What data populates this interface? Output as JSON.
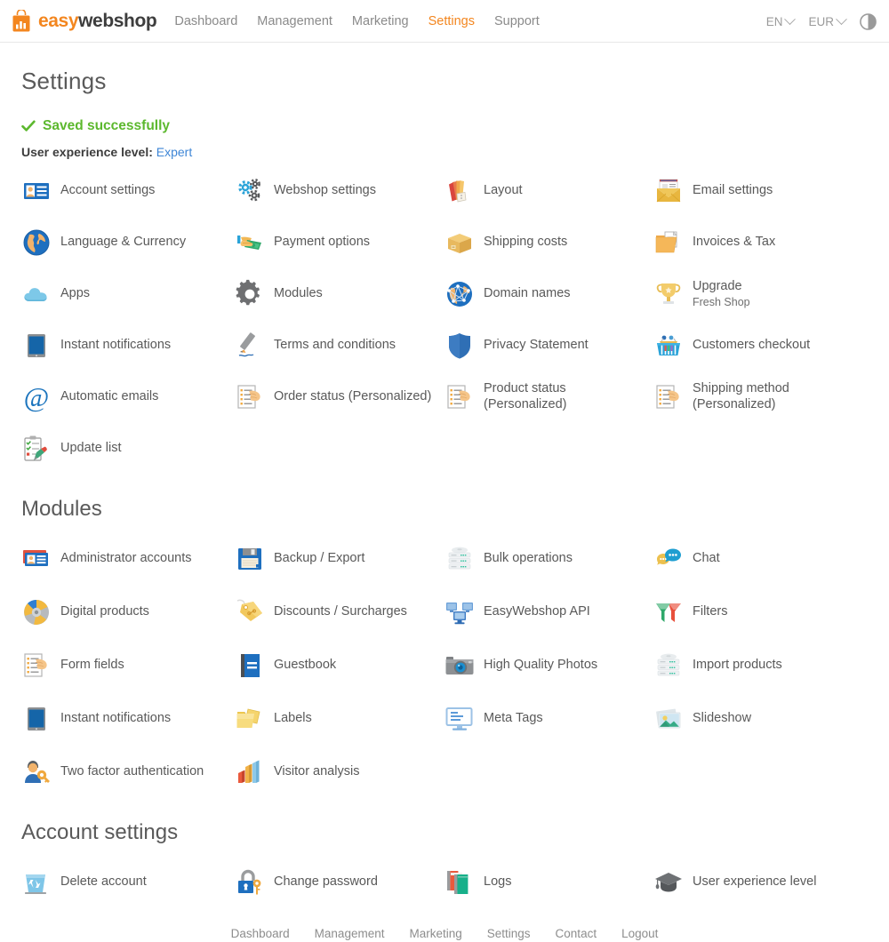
{
  "header": {
    "brand": {
      "part1": "easy",
      "part2": "webshop",
      "icon": "shopping-bag-chart-logo"
    },
    "nav": [
      {
        "label": "Dashboard",
        "active": false
      },
      {
        "label": "Management",
        "active": false
      },
      {
        "label": "Marketing",
        "active": false
      },
      {
        "label": "Settings",
        "active": true
      },
      {
        "label": "Support",
        "active": false
      }
    ],
    "language": "EN",
    "currency": "EUR",
    "theme_toggle_icon": "contrast-half-circle-icon",
    "accent_color": "#F3861F"
  },
  "page": {
    "title": "Settings",
    "saved_message": "Saved successfully",
    "saved_color": "#5cb82e",
    "ux_level_label": "User experience level:",
    "ux_level_value": "Expert",
    "ux_level_link_color": "#3e86d6"
  },
  "sections": [
    {
      "id": "settings",
      "title": "",
      "items": [
        {
          "label": "Account settings",
          "sub": "",
          "icon": "id-card-icon"
        },
        {
          "label": "Webshop settings",
          "sub": "",
          "icon": "gears-icon"
        },
        {
          "label": "Layout",
          "sub": "",
          "icon": "color-swatch-fan-icon"
        },
        {
          "label": "Email settings",
          "sub": "",
          "icon": "envelope-mail-icon"
        },
        {
          "label": "Language & Currency",
          "sub": "",
          "icon": "globe-americas-icon"
        },
        {
          "label": "Payment options",
          "sub": "",
          "icon": "hand-money-icon"
        },
        {
          "label": "Shipping costs",
          "sub": "",
          "icon": "cardboard-box-icon"
        },
        {
          "label": "Invoices & Tax",
          "sub": "",
          "icon": "folder-document-icon"
        },
        {
          "label": "Apps",
          "sub": "",
          "icon": "cloud-icon"
        },
        {
          "label": "Modules",
          "sub": "",
          "icon": "gear-icon"
        },
        {
          "label": "Domain names",
          "sub": "",
          "icon": "globe-network-icon"
        },
        {
          "label": "Upgrade",
          "sub": "Fresh Shop",
          "icon": "trophy-icon"
        },
        {
          "label": "Instant notifications",
          "sub": "",
          "icon": "tablet-device-icon"
        },
        {
          "label": "Terms and conditions",
          "sub": "",
          "icon": "pen-signature-icon"
        },
        {
          "label": "Privacy Statement",
          "sub": "",
          "icon": "shield-icon"
        },
        {
          "label": "Customers checkout",
          "sub": "",
          "icon": "shopping-basket-icon"
        },
        {
          "label": "Automatic emails",
          "sub": "",
          "icon": "at-sign-icon"
        },
        {
          "label": "Order status (Personalized)",
          "sub": "",
          "icon": "checklist-hand-icon"
        },
        {
          "label": "Product status",
          "sub": "(Personalized)",
          "icon": "checklist-hand-icon"
        },
        {
          "label": "Shipping method",
          "sub": "(Personalized)",
          "icon": "checklist-hand-icon"
        },
        {
          "label": "Update list",
          "sub": "",
          "icon": "clipboard-pencil-icon"
        }
      ]
    },
    {
      "id": "modules",
      "title": "Modules",
      "items": [
        {
          "label": "Administrator accounts",
          "sub": "",
          "icon": "id-card-red-icon"
        },
        {
          "label": "Backup / Export",
          "sub": "",
          "icon": "floppy-disk-icon"
        },
        {
          "label": "Bulk operations",
          "sub": "",
          "icon": "server-stack-icon"
        },
        {
          "label": "Chat",
          "sub": "",
          "icon": "chat-bubbles-icon"
        },
        {
          "label": "Digital products",
          "sub": "",
          "icon": "compact-disc-icon"
        },
        {
          "label": "Discounts / Surcharges",
          "sub": "",
          "icon": "price-tag-icon"
        },
        {
          "label": "EasyWebshop API",
          "sub": "",
          "icon": "computers-network-icon"
        },
        {
          "label": "Filters",
          "sub": "",
          "icon": "funnel-filter-icon"
        },
        {
          "label": "Form fields",
          "sub": "",
          "icon": "checklist-hand-icon"
        },
        {
          "label": "Guestbook",
          "sub": "",
          "icon": "blue-book-icon"
        },
        {
          "label": "High Quality Photos",
          "sub": "",
          "icon": "camera-icon"
        },
        {
          "label": "Import products",
          "sub": "",
          "icon": "server-stack-icon"
        },
        {
          "label": "Instant notifications",
          "sub": "",
          "icon": "tablet-device-icon"
        },
        {
          "label": "Labels",
          "sub": "",
          "icon": "yellow-folders-icon"
        },
        {
          "label": "Meta Tags",
          "sub": "",
          "icon": "monitor-text-icon"
        },
        {
          "label": "Slideshow",
          "sub": "",
          "icon": "photo-stack-icon"
        },
        {
          "label": "Two factor authentication",
          "sub": "",
          "icon": "user-key-icon"
        },
        {
          "label": "Visitor analysis",
          "sub": "",
          "icon": "bar-chart-icon"
        }
      ]
    },
    {
      "id": "account",
      "title": "Account settings",
      "items": [
        {
          "label": "Delete account",
          "sub": "",
          "icon": "recycle-bin-icon"
        },
        {
          "label": "Change password",
          "sub": "",
          "icon": "lock-key-icon"
        },
        {
          "label": "Logs",
          "sub": "",
          "icon": "books-icon"
        },
        {
          "label": "User experience level",
          "sub": "",
          "icon": "graduation-cap-icon"
        }
      ]
    }
  ],
  "footer": {
    "links": [
      "Dashboard",
      "Management",
      "Marketing",
      "Settings",
      "Contact",
      "Logout"
    ]
  }
}
